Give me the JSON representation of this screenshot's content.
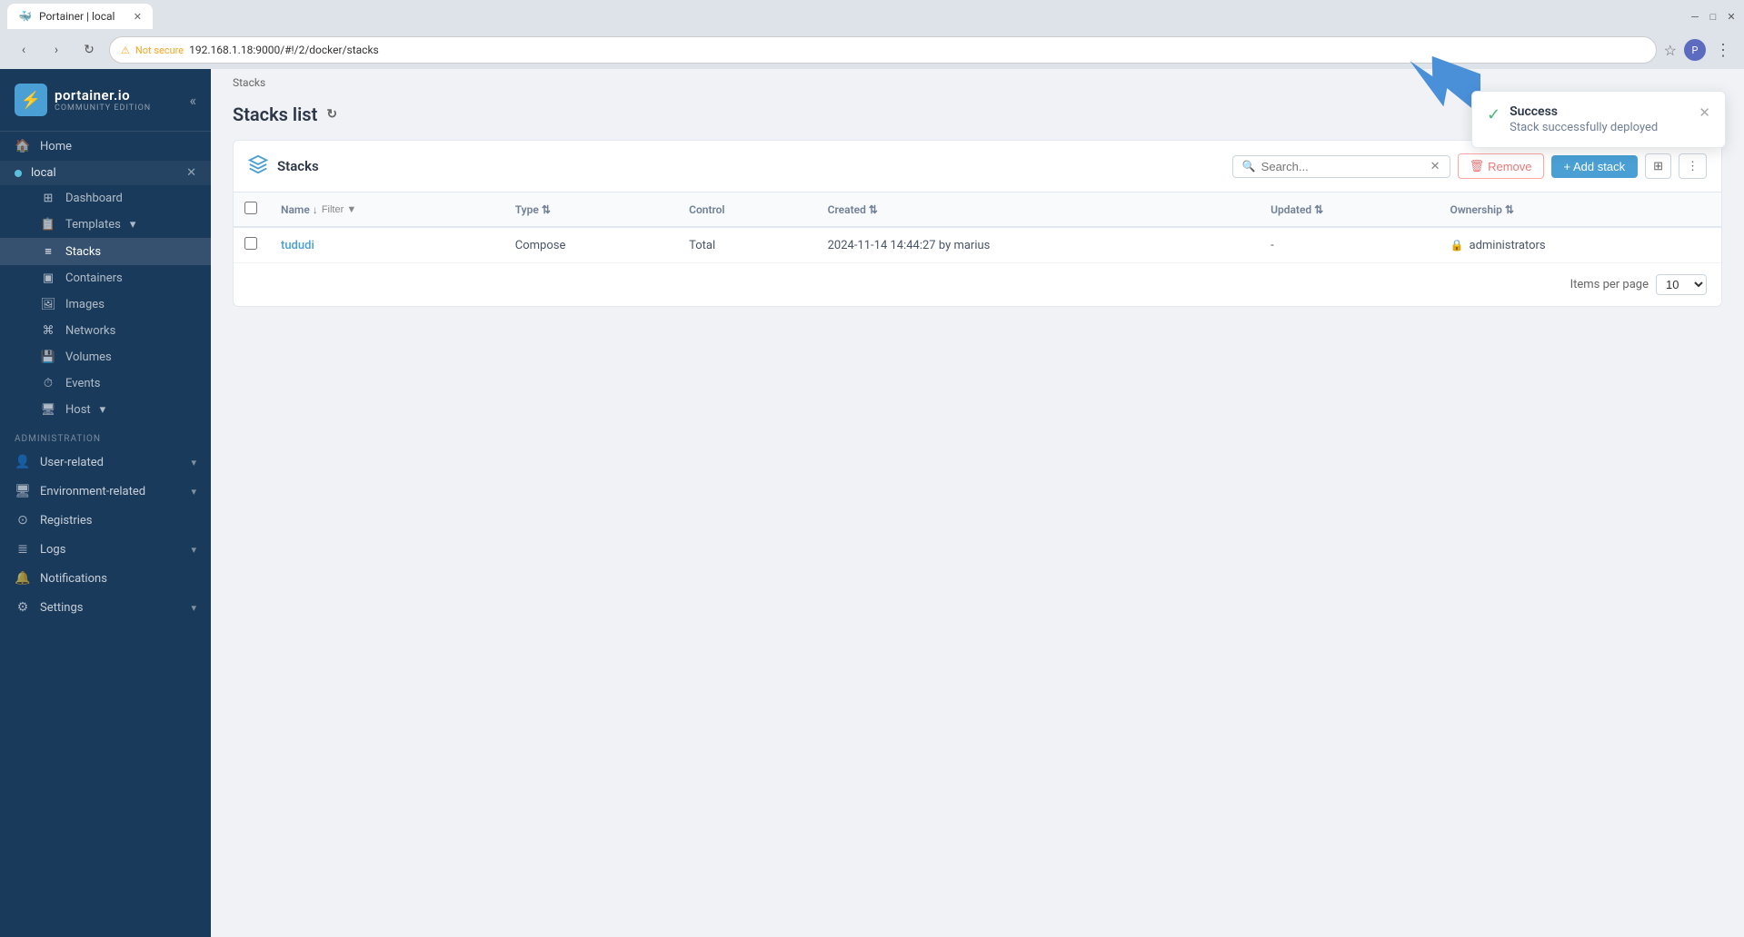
{
  "browser": {
    "url": "192.168.1.18:9000/#!/2/docker/stacks",
    "tab_title": "Portainer | local",
    "not_secure": "Not secure"
  },
  "sidebar": {
    "logo": {
      "name": "portainer.io",
      "edition": "COMMUNITY EDITION"
    },
    "home_label": "Home",
    "env_name": "local",
    "menu_items": [
      {
        "id": "dashboard",
        "label": "Dashboard",
        "icon": "⊞"
      },
      {
        "id": "templates",
        "label": "Templates",
        "icon": "⊡",
        "has_chevron": true
      },
      {
        "id": "stacks",
        "label": "Stacks",
        "icon": "≡",
        "active": true
      },
      {
        "id": "containers",
        "label": "Containers",
        "icon": "▣"
      },
      {
        "id": "images",
        "label": "Images",
        "icon": "⊕"
      },
      {
        "id": "networks",
        "label": "Networks",
        "icon": "⌘"
      },
      {
        "id": "volumes",
        "label": "Volumes",
        "icon": "◫"
      },
      {
        "id": "events",
        "label": "Events",
        "icon": "◷"
      },
      {
        "id": "host",
        "label": "Host",
        "icon": "⊟",
        "has_chevron": true
      }
    ],
    "admin_label": "Administration",
    "admin_items": [
      {
        "id": "user-related",
        "label": "User-related",
        "icon": "👤",
        "has_chevron": true
      },
      {
        "id": "environment-related",
        "label": "Environment-related",
        "icon": "🖥",
        "has_chevron": true
      },
      {
        "id": "registries",
        "label": "Registries",
        "icon": "⊙"
      },
      {
        "id": "logs",
        "label": "Logs",
        "icon": "≣",
        "has_chevron": true
      },
      {
        "id": "notifications",
        "label": "Notifications",
        "icon": "🔔"
      },
      {
        "id": "settings",
        "label": "Settings",
        "icon": "⚙",
        "has_chevron": true
      }
    ]
  },
  "breadcrumb": "Stacks",
  "page_title": "Stacks list",
  "panel": {
    "title": "Stacks",
    "search_placeholder": "Search...",
    "remove_label": "Remove",
    "add_label": "+ Add stack",
    "table": {
      "columns": [
        "Name",
        "Type",
        "Control",
        "Created",
        "Updated",
        "Ownership"
      ],
      "rows": [
        {
          "name": "tududi",
          "type": "Compose",
          "control": "Total",
          "created": "2024-11-14 14:44:27 by marius",
          "updated": "-",
          "ownership": "administrators"
        }
      ]
    },
    "items_per_page_label": "Items per page",
    "items_per_page_value": "10"
  },
  "notification": {
    "title": "Success",
    "message": "Stack successfully deployed"
  }
}
